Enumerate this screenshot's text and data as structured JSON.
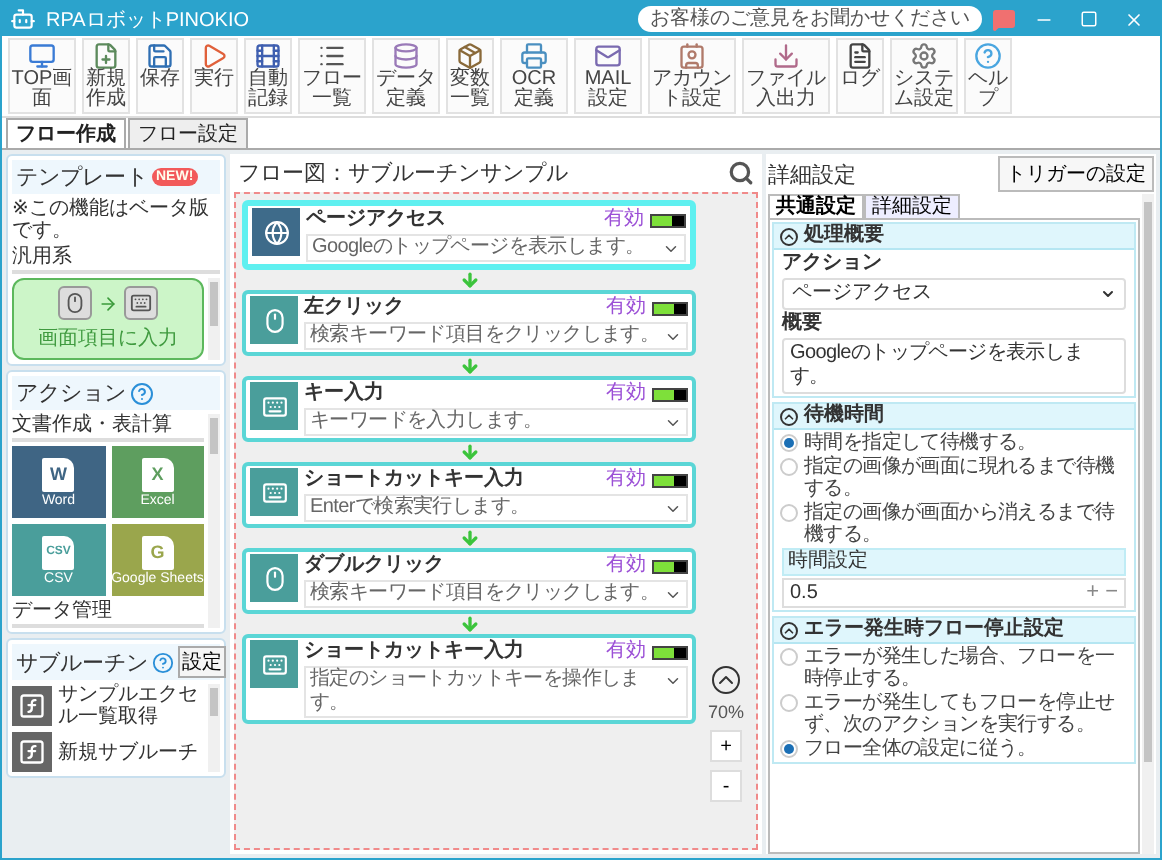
{
  "window": {
    "title": "RPAロボットPINOKIO",
    "feedback": "お客様のご意見をお聞かせください"
  },
  "toolbar": [
    {
      "label": "TOP画面",
      "kind": "top"
    },
    {
      "label": "新規作成",
      "kind": "new"
    },
    {
      "label": "保存",
      "kind": "save"
    },
    {
      "label": "実行",
      "kind": "run"
    },
    {
      "label": "自動記録",
      "kind": "record"
    },
    {
      "label": "フロー一覧",
      "kind": "list"
    },
    {
      "label": "データ定義",
      "kind": "data"
    },
    {
      "label": "変数一覧",
      "kind": "box"
    },
    {
      "label": "OCR定義",
      "kind": "ocr"
    },
    {
      "label": "MAIL設定",
      "kind": "mail"
    },
    {
      "label": "アカウント設定",
      "kind": "account"
    },
    {
      "label": "ファイル入出力",
      "kind": "file"
    },
    {
      "label": "ログ",
      "kind": "log"
    },
    {
      "label": "システム設定",
      "kind": "gear"
    },
    {
      "label": "ヘルプ",
      "kind": "help"
    }
  ],
  "tabs": [
    {
      "label": "フロー作成",
      "selected": true
    },
    {
      "label": "フロー設定",
      "selected": false
    }
  ],
  "left_panel": {
    "template": {
      "title": "テンプレート",
      "badge": "NEW!",
      "note": "※この機能はベータ版です。",
      "category": "汎用系",
      "items": [
        {
          "label": "画面項目に入力"
        }
      ]
    },
    "actions": {
      "title": "アクション",
      "category": "文書作成・表計算",
      "tiles": [
        {
          "label": "Word",
          "letter": "W",
          "color": "#3f6584"
        },
        {
          "label": "Excel",
          "letter": "X",
          "color": "#5e9e5f"
        },
        {
          "label": "CSV",
          "letter": "CSV",
          "color": "#4a9e9b"
        },
        {
          "label": "Google Sheets",
          "letter": "G",
          "color": "#9aa64c"
        }
      ],
      "next_category": "データ管理"
    },
    "subroutines": {
      "title": "サブルーチン",
      "settings_button": "設定",
      "items": [
        {
          "label": "サンプルエクセル一覧取得"
        },
        {
          "label": "新規サブルーチ"
        }
      ]
    }
  },
  "flow": {
    "title": "フロー図：サブルーチンサンプル",
    "steps": [
      {
        "title": "ページアクセス",
        "kind": "web",
        "status": "有効",
        "enabled": true,
        "selected": true,
        "description": "Googleのトップページを表示します。"
      },
      {
        "title": "左クリック",
        "kind": "mouse",
        "status": "有効",
        "enabled": true,
        "selected": false,
        "description": "検索キーワード項目をクリックします。"
      },
      {
        "title": "キー入力",
        "kind": "keyboard",
        "status": "有効",
        "enabled": true,
        "selected": false,
        "description": "キーワードを入力します。"
      },
      {
        "title": "ショートカットキー入力",
        "kind": "keyboard",
        "status": "有効",
        "enabled": true,
        "selected": false,
        "description": "Enterで検索実行します。"
      },
      {
        "title": "ダブルクリック",
        "kind": "mouse",
        "status": "有効",
        "enabled": true,
        "selected": false,
        "description": "検索キーワード項目をクリックします。"
      },
      {
        "title": "ショートカットキー入力",
        "kind": "keyboard",
        "status": "有効",
        "enabled": true,
        "selected": false,
        "description": "指定のショートカットキーを操作します。"
      }
    ],
    "zoom": "70%",
    "zoom_in": "+",
    "zoom_out": "-"
  },
  "details": {
    "title": "詳細設定",
    "trigger_button": "トリガーの設定",
    "tabs": [
      {
        "label": "共通設定",
        "selected": true
      },
      {
        "label": "詳細設定",
        "selected": false
      }
    ],
    "summary": {
      "title": "処理概要",
      "action_label": "アクション",
      "action_value": "ページアクセス",
      "overview_label": "概要",
      "overview_value": "Googleのトップページを表示します。"
    },
    "wait": {
      "title": "待機時間",
      "options": [
        {
          "label": "時間を指定して待機する。",
          "selected": true
        },
        {
          "label": "指定の画像が画面に現れるまで待機する。",
          "selected": false
        },
        {
          "label": "指定の画像が画面から消えるまで待機する。",
          "selected": false
        }
      ],
      "time_label": "時間設定",
      "time_value": "0.5",
      "increment": "+",
      "decrement": "−"
    },
    "error": {
      "title": "エラー発生時フロー停止設定",
      "options": [
        {
          "label": "エラーが発生した場合、フローを一時停止する。",
          "selected": false
        },
        {
          "label": "エラーが発生してもフローを停止せず、次のアクションを実行する。",
          "selected": false
        },
        {
          "label": "フロー全体の設定に従う。",
          "selected": true
        }
      ]
    }
  }
}
